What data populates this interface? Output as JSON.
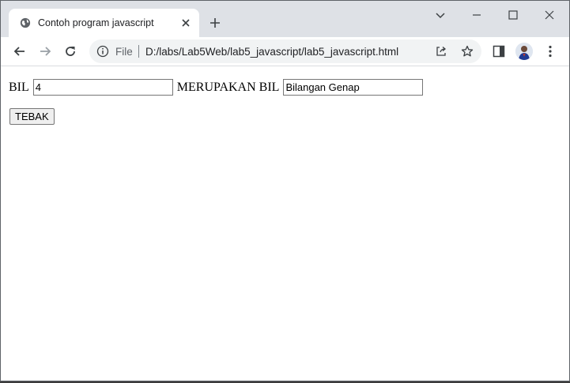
{
  "browser": {
    "tab": {
      "title": "Contoh program javascript"
    },
    "address": {
      "scheme": "File",
      "url": "D:/labs/Lab5Web/lab5_javascript/lab5_javascript.html"
    }
  },
  "icons": {
    "favicon": "globe-icon",
    "tab_close": "close-icon",
    "new_tab": "plus-icon",
    "tab_search": "chevron-down-icon",
    "minimize": "minimize-icon",
    "maximize": "maximize-icon",
    "close_window": "close-icon",
    "back": "arrow-left-icon",
    "forward": "arrow-right-icon",
    "reload": "reload-icon",
    "site_info": "info-icon",
    "share": "share-icon",
    "bookmark": "star-icon",
    "side_panel": "side-panel-icon",
    "profile": "avatar",
    "menu": "kebab-menu-icon"
  },
  "page": {
    "label_bil": "BIL",
    "input_bil_value": "4",
    "label_merupakan": "MERUPAKAN BIL",
    "input_result_value": "Bilangan Genap",
    "button_label": "TEBAK"
  }
}
